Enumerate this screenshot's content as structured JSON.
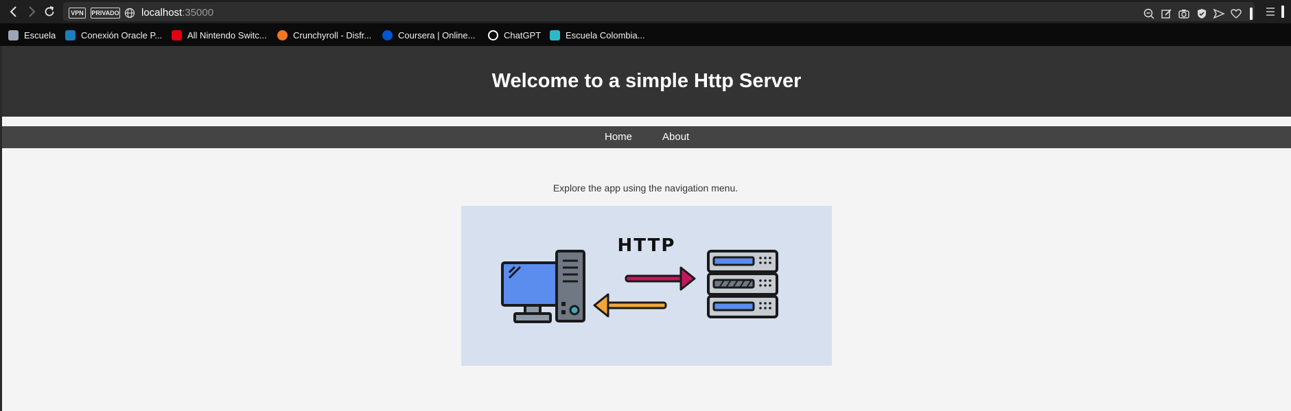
{
  "browser": {
    "back_icon": "chevron-left-icon",
    "forward_icon": "chevron-right-icon",
    "reload_icon": "reload-icon",
    "vpn_badge": "VPN",
    "private_badge": "PRIVADO",
    "url_host": "localhost",
    "url_port": ":35000",
    "toolbar_icons": [
      "zoom-out-icon",
      "edit-icon",
      "camera-icon",
      "shield-icon",
      "send-icon",
      "heart-icon",
      "menu-icon"
    ]
  },
  "bookmarks": [
    {
      "label": "Escuela",
      "color": "#9aa6b5"
    },
    {
      "label": "Conexión Oracle P...",
      "color": "#1b7ec2"
    },
    {
      "label": "All Nintendo Switc...",
      "color": "#e4000f"
    },
    {
      "label": "Crunchyroll - Disfr...",
      "color": "#f47521"
    },
    {
      "label": "Coursera | Online...",
      "color": "#0056d2"
    },
    {
      "label": "ChatGPT",
      "color": "#ffffff"
    },
    {
      "label": "Escuela Colombia...",
      "color": "#2fb7c9"
    }
  ],
  "page": {
    "title": "Welcome to a simple Http Server",
    "nav": [
      "Home",
      "About"
    ],
    "intro": "Explore the app using the navigation menu.",
    "illustration_text": "HTTP"
  }
}
